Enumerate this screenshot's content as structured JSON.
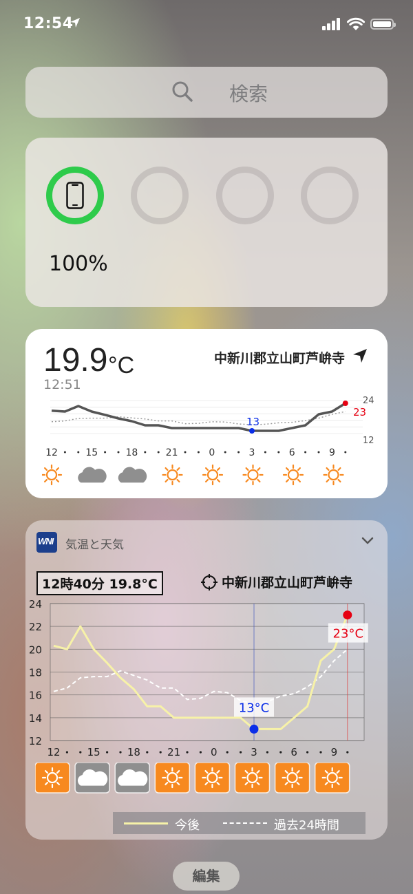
{
  "status_bar": {
    "time": "12:54"
  },
  "search": {
    "placeholder": "検索"
  },
  "battery_widget": {
    "percent_label": "100%",
    "device_level": 1.0
  },
  "weather_widget": {
    "temperature": "19.9",
    "unit": "°C",
    "time": "12:51",
    "location": "中新川郡立山町芦峅寺",
    "axis_max": "24",
    "axis_min": "12",
    "high_label": "23",
    "low_label": "13",
    "hour_labels": [
      "12",
      "15",
      "18",
      "21",
      "0",
      "3",
      "6",
      "9"
    ],
    "forecast_icons": [
      "sun-icon",
      "cloud-icon",
      "cloud-icon",
      "sun-icon",
      "sun-icon",
      "sun-icon",
      "sun-icon",
      "sun-icon"
    ]
  },
  "weather_detail_widget": {
    "app_name": "気温と天気",
    "current_time_temp": "12時40分 19.8°C",
    "location": "中新川郡立山町芦峅寺",
    "high_label": "23°C",
    "low_label": "13°C",
    "legend_future": "今後",
    "legend_past": "過去24時間",
    "forecast_icons": [
      "sun-icon",
      "cloud-icon",
      "cloud-icon",
      "sun-icon",
      "sun-icon",
      "sun-icon",
      "sun-icon",
      "sun-icon"
    ]
  },
  "chart_data": {
    "type": "line",
    "title": "",
    "xlabel": "",
    "ylabel": "",
    "x": [
      12,
      13,
      14,
      15,
      16,
      17,
      18,
      19,
      20,
      21,
      22,
      23,
      0,
      1,
      2,
      3,
      4,
      5,
      6,
      7,
      8,
      9,
      10
    ],
    "x_tick_labels": [
      "12",
      "15",
      "18",
      "21",
      "0",
      "3",
      "6",
      "9"
    ],
    "y_ticks": [
      "12",
      "14",
      "16",
      "18",
      "20",
      "22",
      "24"
    ],
    "ylim": [
      12,
      24
    ],
    "grid": true,
    "series": [
      {
        "name": "今後",
        "values": [
          20.3,
          20.0,
          22.0,
          20.0,
          18.8,
          17.5,
          16.5,
          15.0,
          15.0,
          14.0,
          14.0,
          14.0,
          14.0,
          14.0,
          14.0,
          13.0,
          13.0,
          13.0,
          14.0,
          15.0,
          19.0,
          20.0,
          23.0
        ]
      },
      {
        "name": "過去24時間",
        "values": [
          16.3,
          16.6,
          17.5,
          17.6,
          17.6,
          18.1,
          17.7,
          17.3,
          16.6,
          16.6,
          15.6,
          15.7,
          16.3,
          16.2,
          15.5,
          15.2,
          15.4,
          15.9,
          16.1,
          16.7,
          17.6,
          19.0,
          20.0
        ]
      }
    ],
    "markers": [
      {
        "x": 3,
        "y": 13,
        "label": "13°C",
        "color": "#0a2ee8"
      },
      {
        "x": 10,
        "y": 23,
        "label": "23°C",
        "color": "#e60012"
      }
    ]
  },
  "colors": {
    "ring_active": "#2ecb4b",
    "sun_badge": "#f7891f",
    "cloud_badge": "#8f8f8f",
    "high": "#e60012",
    "low": "#0a2ee8"
  },
  "edit_button": {
    "label": "編集"
  }
}
